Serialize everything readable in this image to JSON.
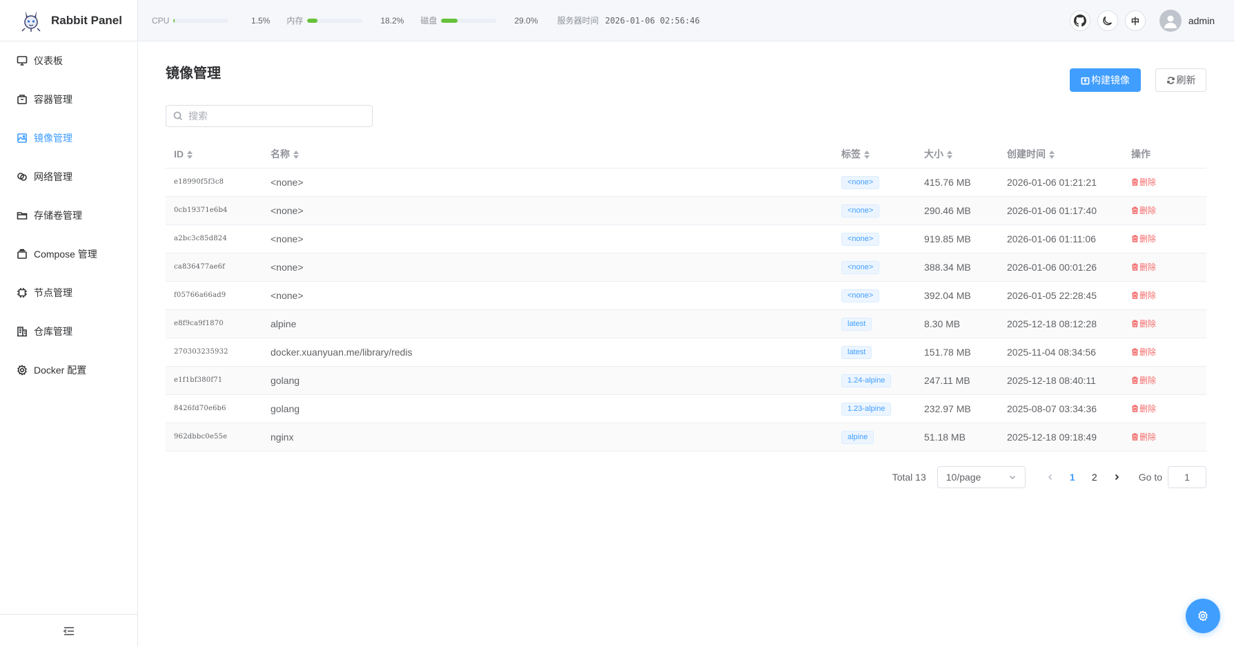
{
  "app": {
    "name": "Rabbit Panel"
  },
  "sidebar": {
    "items": [
      {
        "label": "仪表板",
        "icon": "monitor-icon"
      },
      {
        "label": "容器管理",
        "icon": "box-icon"
      },
      {
        "label": "镜像管理",
        "icon": "picture-icon",
        "active": true
      },
      {
        "label": "网络管理",
        "icon": "link-icon"
      },
      {
        "label": "存储卷管理",
        "icon": "folder-icon"
      },
      {
        "label": "Compose 管理",
        "icon": "stack-icon"
      },
      {
        "label": "节点管理",
        "icon": "cpu-icon"
      },
      {
        "label": "仓库管理",
        "icon": "building-icon"
      },
      {
        "label": "Docker 配置",
        "icon": "gear-icon"
      }
    ]
  },
  "header": {
    "cpu": {
      "label": "CPU",
      "value": "1.5%",
      "percent": 1.5
    },
    "mem": {
      "label": "内存",
      "value": "18.2%",
      "percent": 18.2
    },
    "disk": {
      "label": "磁盘",
      "value": "29.0%",
      "percent": 29.0
    },
    "server_time_label": "服务器时间",
    "server_time": "2026-01-06 02:56:46",
    "lang": "中",
    "username": "admin"
  },
  "main": {
    "title": "镜像管理",
    "build_label": "构建镜像",
    "refresh_label": "刷新",
    "search_placeholder": "搜索",
    "columns": {
      "id": "ID",
      "name": "名称",
      "tag": "标签",
      "size": "大小",
      "created": "创建时间",
      "ops": "操作"
    },
    "delete_label": "删除",
    "rows": [
      {
        "id": "e18990f5f3c8",
        "name": "<none>",
        "tag": "<none>",
        "size": "415.76 MB",
        "created": "2026-01-06 01:21:21"
      },
      {
        "id": "0cb19371e6b4",
        "name": "<none>",
        "tag": "<none>",
        "size": "290.46 MB",
        "created": "2026-01-06 01:17:40"
      },
      {
        "id": "a2bc3c85d824",
        "name": "<none>",
        "tag": "<none>",
        "size": "919.85 MB",
        "created": "2026-01-06 01:11:06"
      },
      {
        "id": "ca836477ae6f",
        "name": "<none>",
        "tag": "<none>",
        "size": "388.34 MB",
        "created": "2026-01-06 00:01:26"
      },
      {
        "id": "f05766a66ad9",
        "name": "<none>",
        "tag": "<none>",
        "size": "392.04 MB",
        "created": "2026-01-05 22:28:45"
      },
      {
        "id": "e8f9ca9f1870",
        "name": "alpine",
        "tag": "latest",
        "size": "8.30 MB",
        "created": "2025-12-18 08:12:28"
      },
      {
        "id": "270303235932",
        "name": "docker.xuanyuan.me/library/redis",
        "tag": "latest",
        "size": "151.78 MB",
        "created": "2025-11-04 08:34:56"
      },
      {
        "id": "e1f1bf380f71",
        "name": "golang",
        "tag": "1.24-alpine",
        "size": "247.11 MB",
        "created": "2025-12-18 08:40:11"
      },
      {
        "id": "8426fd70e6b6",
        "name": "golang",
        "tag": "1.23-alpine",
        "size": "232.97 MB",
        "created": "2025-08-07 03:34:36"
      },
      {
        "id": "962dbbc0e55e",
        "name": "nginx",
        "tag": "alpine",
        "size": "51.18 MB",
        "created": "2025-12-18 09:18:49"
      }
    ]
  },
  "pagination": {
    "total": "Total 13",
    "page_size": "10/page",
    "pages": [
      "1",
      "2"
    ],
    "current": "1",
    "goto_label": "Go to",
    "goto_value": "1"
  },
  "colors": {
    "accent": "#409eff",
    "danger": "#f56c6c",
    "success": "#67c23a"
  }
}
